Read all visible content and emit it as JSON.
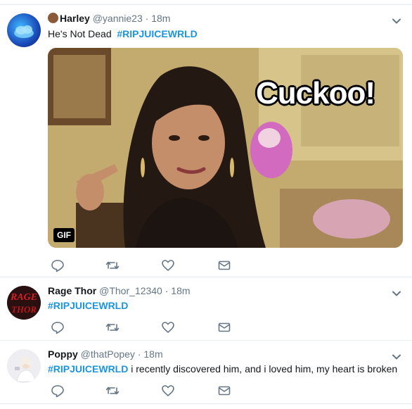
{
  "tweets": [
    {
      "name": "Harley",
      "handle": "@yannie23",
      "dot": "·",
      "time": "18m",
      "text": "He's Not Dead",
      "hashtag": "#RIPJUICEWRLD",
      "media": {
        "caption": "Cuckoo!",
        "badge": "GIF"
      }
    },
    {
      "name": "Rage Thor",
      "handle": "@Thor_12340",
      "dot": "·",
      "time": "18m",
      "hashtag": "#RIPJUICEWRLD",
      "avatar_text_top": "RAGE",
      "avatar_text_bottom": "THOR"
    },
    {
      "name": "Poppy",
      "handle": "@thatPopey",
      "dot": "·",
      "time": "18m",
      "hashtag": "#RIPJUICEWRLD",
      "text": "i recently discovered him, and i loved him, my heart is broken"
    }
  ],
  "icons": [
    "reply-icon",
    "retweet-icon",
    "like-icon",
    "direct-message-icon",
    "chevron-down-icon"
  ],
  "colors": {
    "accent": "#1b95e0",
    "secondary_text": "#657786",
    "divider": "#e6ecf0",
    "icon": "#657786"
  }
}
